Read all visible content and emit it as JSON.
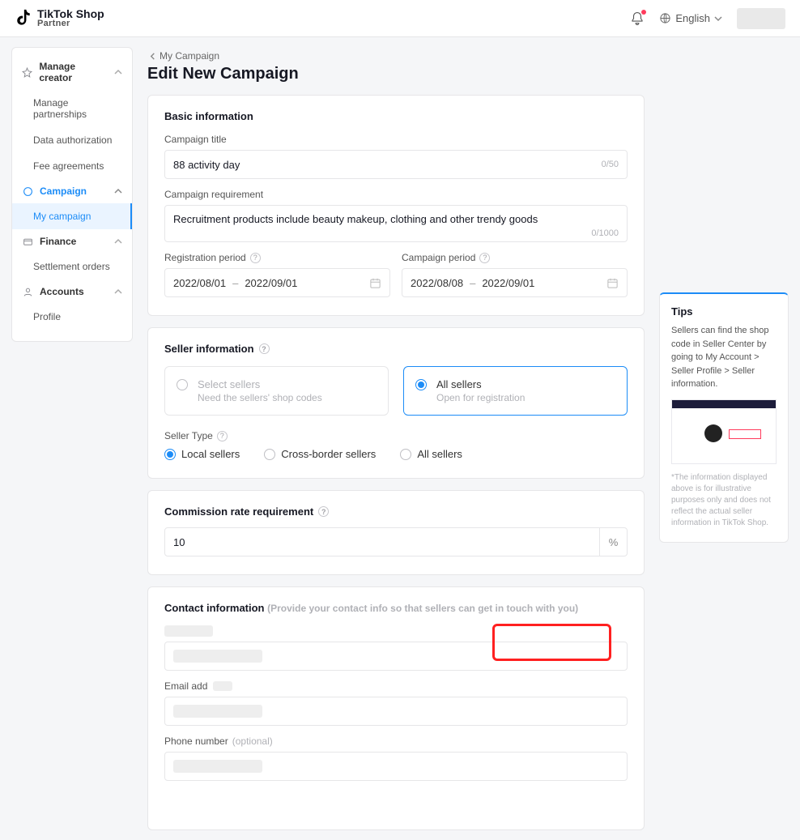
{
  "header": {
    "brand_l1": "TikTok Shop",
    "brand_l2": "Partner",
    "language": "English"
  },
  "sidebar": {
    "sections": [
      {
        "icon": "star",
        "label": "Manage creator",
        "items": [
          {
            "label": "Manage partnerships"
          },
          {
            "label": "Data authorization"
          },
          {
            "label": "Fee agreements"
          }
        ]
      },
      {
        "icon": "megaphone",
        "label": "Campaign",
        "active": true,
        "items": [
          {
            "label": "My campaign",
            "active": true
          }
        ]
      },
      {
        "icon": "wallet",
        "label": "Finance",
        "items": [
          {
            "label": "Settlement orders"
          }
        ]
      },
      {
        "icon": "user",
        "label": "Accounts",
        "items": [
          {
            "label": "Profile"
          }
        ]
      }
    ]
  },
  "breadcrumb": "My Campaign",
  "page_title": "Edit New Campaign",
  "basic": {
    "section": "Basic information",
    "campaign_title_label": "Campaign title",
    "campaign_title_value": "88 activity day",
    "campaign_title_counter": "0/50",
    "requirement_label": "Campaign requirement",
    "requirement_value": "Recruitment products include beauty makeup, clothing and other trendy goods",
    "requirement_counter": "0/1000",
    "registration_label": "Registration period",
    "registration_from": "2022/08/01",
    "registration_to": "2022/09/01",
    "campaign_period_label": "Campaign period",
    "campaign_from": "2022/08/08",
    "campaign_to": "2022/09/01"
  },
  "seller": {
    "section": "Seller information",
    "choice_select_title": "Select sellers",
    "choice_select_sub": "Need the sellers' shop codes",
    "choice_all_title": "All sellers",
    "choice_all_sub": "Open for registration",
    "seller_type_label": "Seller Type",
    "type_local": "Local sellers",
    "type_cross": "Cross-border sellers",
    "type_all": "All sellers"
  },
  "commission": {
    "section": "Commission rate requirement",
    "value": "10",
    "unit": "%"
  },
  "contact": {
    "section": "Contact information",
    "section_hint": "(Provide your contact info so that sellers can get in touch with you)",
    "email_label": "Email add",
    "phone_label": "Phone number",
    "phone_optional": "(optional)"
  },
  "tips": {
    "title": "Tips",
    "body": "Sellers can find the shop code in Seller Center by going to My Account > Seller Profile > Seller information.",
    "footnote": "*The information displayed above is for illustrative purposes only and does not reflect the actual seller information in TikTok Shop."
  }
}
